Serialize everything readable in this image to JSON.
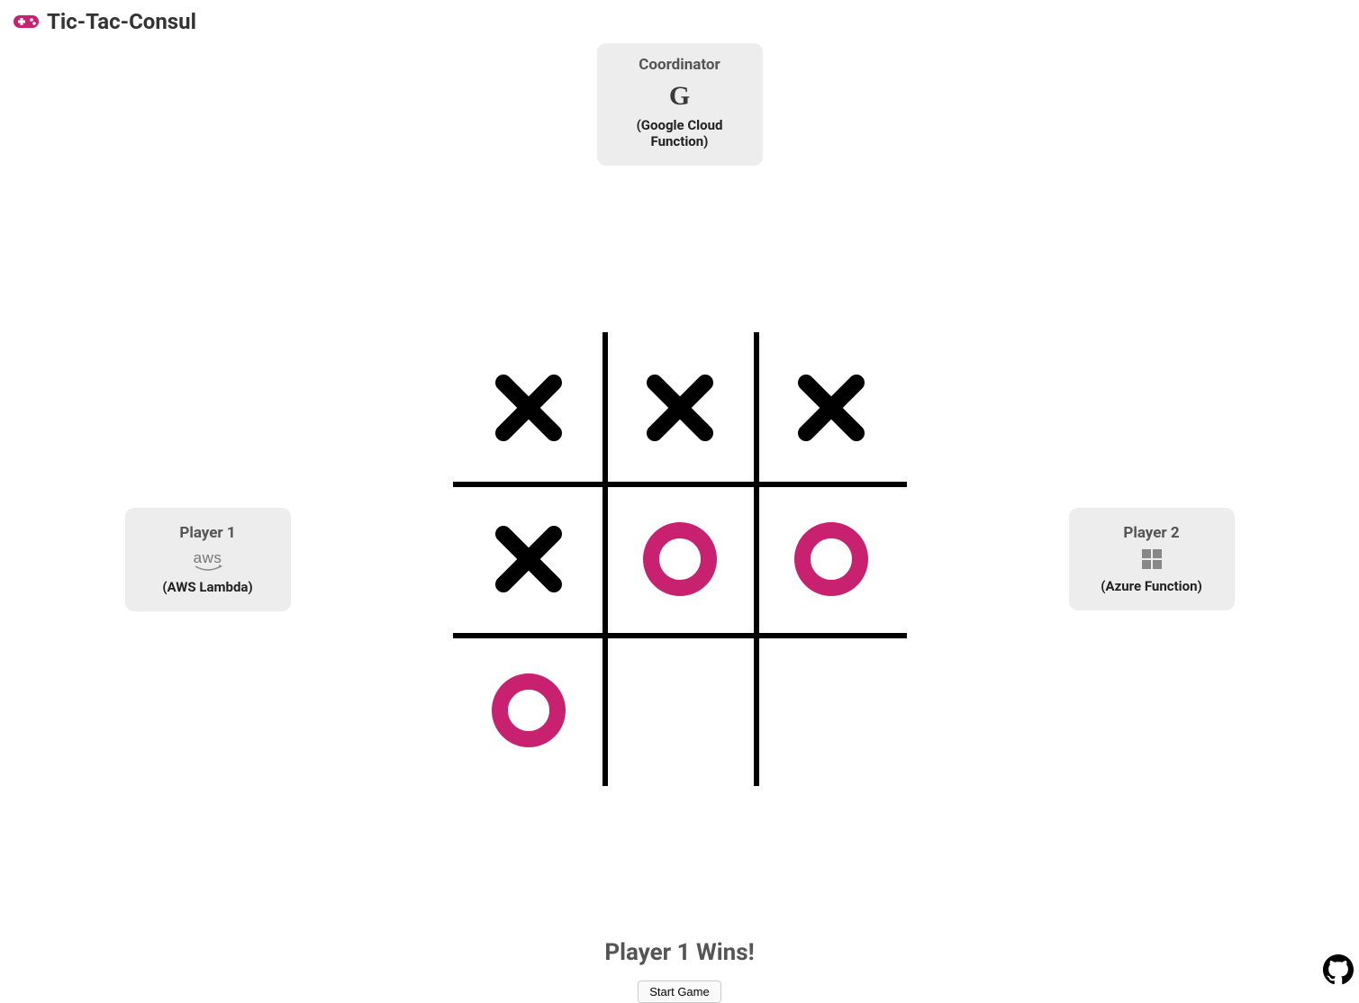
{
  "header": {
    "title": "Tic-Tac-Consul"
  },
  "coordinator": {
    "title": "Coordinator",
    "sub": "(Google Cloud Function)"
  },
  "player1": {
    "title": "Player 1",
    "sub": "(AWS Lambda)"
  },
  "player2": {
    "title": "Player 2",
    "sub": "(Azure Function)"
  },
  "board": {
    "cells": [
      "X",
      "X",
      "X",
      "X",
      "O",
      "O",
      "O",
      "",
      ""
    ]
  },
  "colors": {
    "x": "#000000",
    "o": "#c8216f",
    "accent": "#c8216f"
  },
  "status": "Player 1 Wins!",
  "actions": {
    "start": "Start Game"
  },
  "aws_label": "aws"
}
